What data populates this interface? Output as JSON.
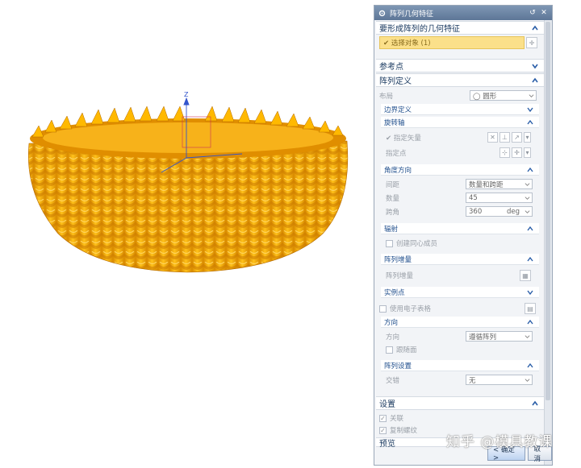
{
  "dialog": {
    "title": "阵列几何特征",
    "source_group": {
      "title": "要形成阵列的几何特征",
      "select_label": "✔ 选择对象 (1)"
    },
    "reference_point": {
      "title": "参考点"
    },
    "array_definition": {
      "title": "阵列定义",
      "layout_label": "布局",
      "layout_value": "◯ 圆形",
      "boundary": {
        "title": "边界定义"
      },
      "rotation_axis": {
        "title": "旋转轴",
        "vector_label": "✔ 指定矢量",
        "point_label": "指定点"
      },
      "angle_direction": {
        "title": "角度方向",
        "spacing_label": "间距",
        "spacing_value": "数量和跨距",
        "count_label": "数量",
        "count_value": "45",
        "span_label": "跨角",
        "span_value": "360",
        "span_unit": "deg"
      },
      "radiate": {
        "title": "辐射",
        "concentric_label": "创建同心成员"
      },
      "increment": {
        "title": "阵列增量",
        "label": "阵列增量"
      },
      "instance": {
        "title": "实例点",
        "spreadsheet_label": "使用电子表格"
      },
      "orientation": {
        "title": "方向",
        "label": "方向",
        "value": "遵循阵列",
        "follow_face_label": "跟随面"
      },
      "settings_sub": {
        "title": "阵列设置",
        "stagger_label": "交错",
        "stagger_value": "无"
      }
    },
    "settings": {
      "title": "设置",
      "assoc_label": "关联",
      "copy_thread_label": "复制螺纹"
    },
    "preview": {
      "title": "预览"
    },
    "buttons": {
      "ok": "< 确定 >",
      "cancel": "取消"
    }
  },
  "viewport": {
    "axis_label": "Z",
    "model_color": "#f5a300"
  },
  "watermark": "知乎 @模具教课"
}
